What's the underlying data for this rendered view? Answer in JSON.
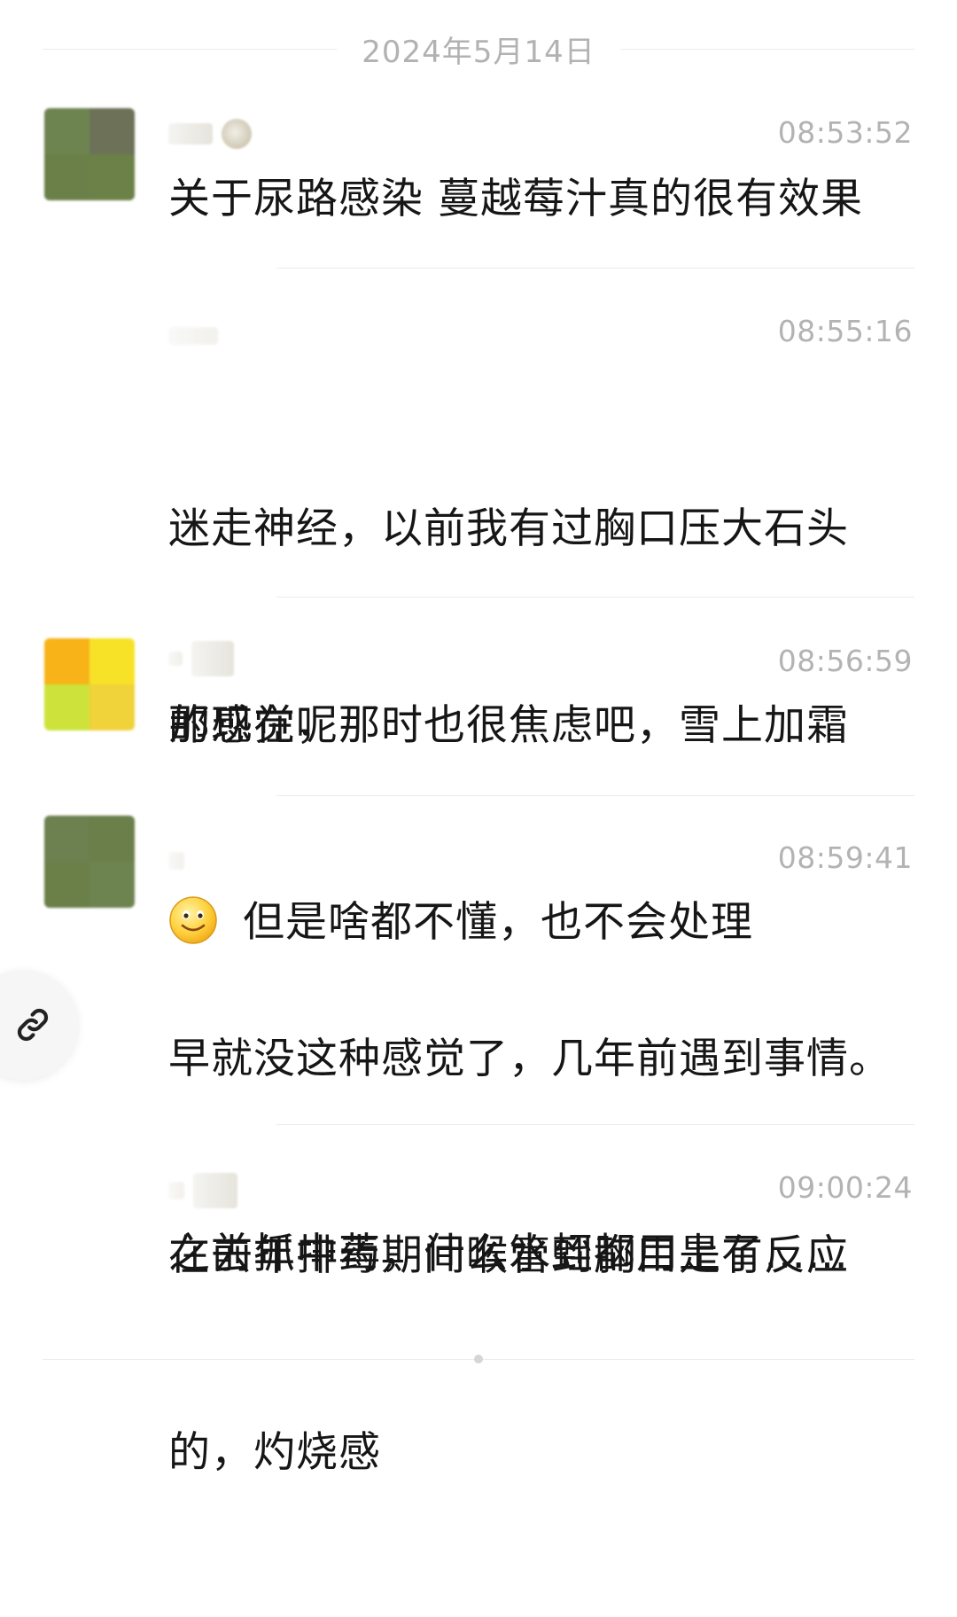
{
  "date_divider": "2024年5月14日",
  "messages": [
    {
      "time": "08:53:52",
      "text": "关于尿路感染 蔓越莓汁真的很有效果",
      "has_avatar": true,
      "avatar_colors": [
        "#6e8450",
        "#6c7158",
        "#6a8048",
        "#6b8148"
      ]
    },
    {
      "time": "08:55:16",
      "text_line1": "迷走神经，以前我有过胸口压大石头",
      "text_line2": "的感觉，那时也很焦虑吧，雪上加霜",
      "text_line3": "但是啥都不懂，也不会处理",
      "has_avatar": false,
      "emoji": "smile-emoji"
    },
    {
      "time": "08:56:59",
      "text": "那现在呢",
      "has_avatar": true,
      "avatar_colors": [
        "#f7b318",
        "#f8e227",
        "#cde33b",
        "#f0d23a"
      ]
    },
    {
      "time": "08:59:41",
      "text_line1": "早就没这种感觉了，几年前遇到事情。",
      "text_line2": "在去年排毒期间喉管到胸口是有反应",
      "text_line3": "的，灼烧感",
      "has_avatar": true,
      "avatar_colors": [
        "#6c8050",
        "#6a7f4a",
        "#6a8048",
        "#6e8450"
      ]
    },
    {
      "time": "09:00:24",
      "text": "之前抓中药，什么水蛭都用上了……",
      "has_avatar": false
    }
  ],
  "link_icon": "link-icon"
}
